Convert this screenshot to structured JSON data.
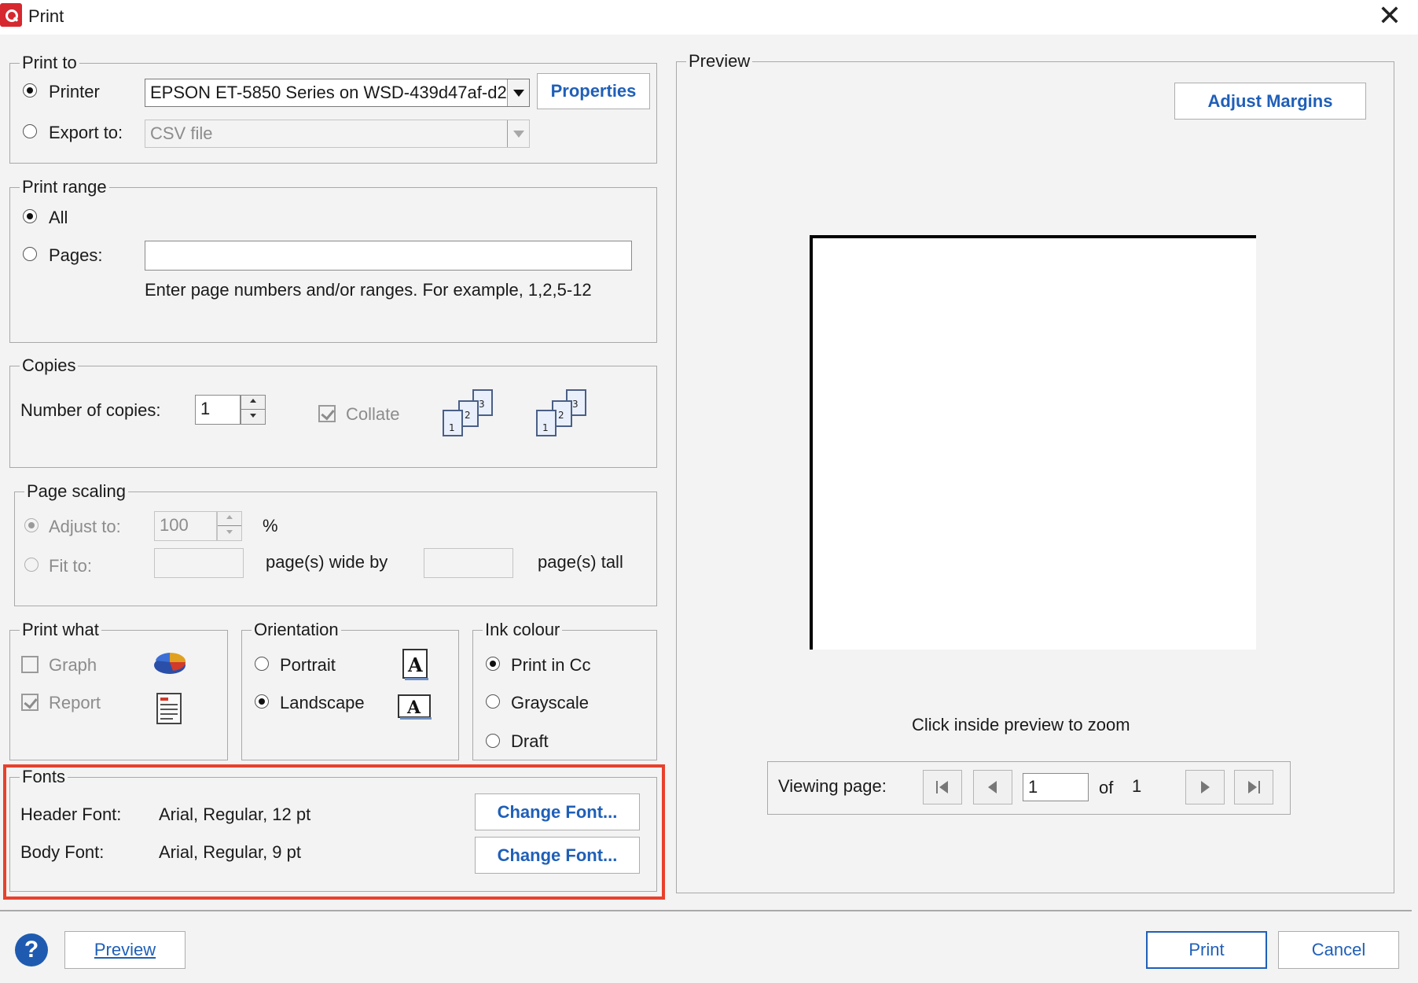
{
  "window": {
    "title": "Print",
    "app_icon": "app-logo-icon",
    "close_icon": "close-icon",
    "close_glyph": "✕"
  },
  "print_to": {
    "legend": "Print to",
    "printer_label": "Printer",
    "printer_selected": true,
    "printer_value": "EPSON ET-5850 Series on WSD-439d47af-d2",
    "properties_label": "Properties",
    "export_label": "Export to:",
    "export_value": "CSV file"
  },
  "print_range": {
    "legend": "Print range",
    "all_label": "All",
    "pages_label": "Pages:",
    "pages_value": "",
    "hint": "Enter page numbers and/or ranges. For example, 1,2,5-12"
  },
  "copies": {
    "legend": "Copies",
    "number_label": "Number of copies:",
    "number_value": "1",
    "collate_label": "Collate",
    "collate_checked": true
  },
  "page_scaling": {
    "legend": "Page scaling",
    "adjust_label": "Adjust to:",
    "adjust_value": "100",
    "percent_sign": "%",
    "fit_label": "Fit to:",
    "wide_label": "page(s) wide by",
    "tall_label": "page(s) tall"
  },
  "print_what": {
    "legend": "Print what",
    "graph_label": "Graph",
    "graph_checked": false,
    "report_label": "Report",
    "report_checked": true
  },
  "orientation": {
    "legend": "Orientation",
    "portrait_label": "Portrait",
    "landscape_label": "Landscape",
    "selected": "Landscape"
  },
  "ink_colour": {
    "legend": "Ink colour",
    "colour_label": "Print in Cc",
    "grayscale_label": "Grayscale",
    "draft_label": "Draft",
    "selected": "Print in Cc"
  },
  "fonts": {
    "legend": "Fonts",
    "header_label": "Header Font:",
    "header_value": "Arial, Regular, 12 pt",
    "body_label": "Body Font:",
    "body_value": "Arial, Regular, 9 pt",
    "change_label": "Change Font...",
    "highlight_color": "#e8412c"
  },
  "preview_panel": {
    "legend": "Preview",
    "adjust_margins_label": "Adjust Margins",
    "zoom_hint": "Click inside preview to zoom",
    "viewing_label": "Viewing page:",
    "page_value": "1",
    "of_label": "of",
    "total_pages": "1"
  },
  "footer": {
    "help_glyph": "?",
    "preview_label": "Preview",
    "print_label": "Print",
    "cancel_label": "Cancel"
  },
  "colors": {
    "accent": "#1f5fb8",
    "help": "#1e5bb0",
    "highlight": "#e8412c"
  }
}
